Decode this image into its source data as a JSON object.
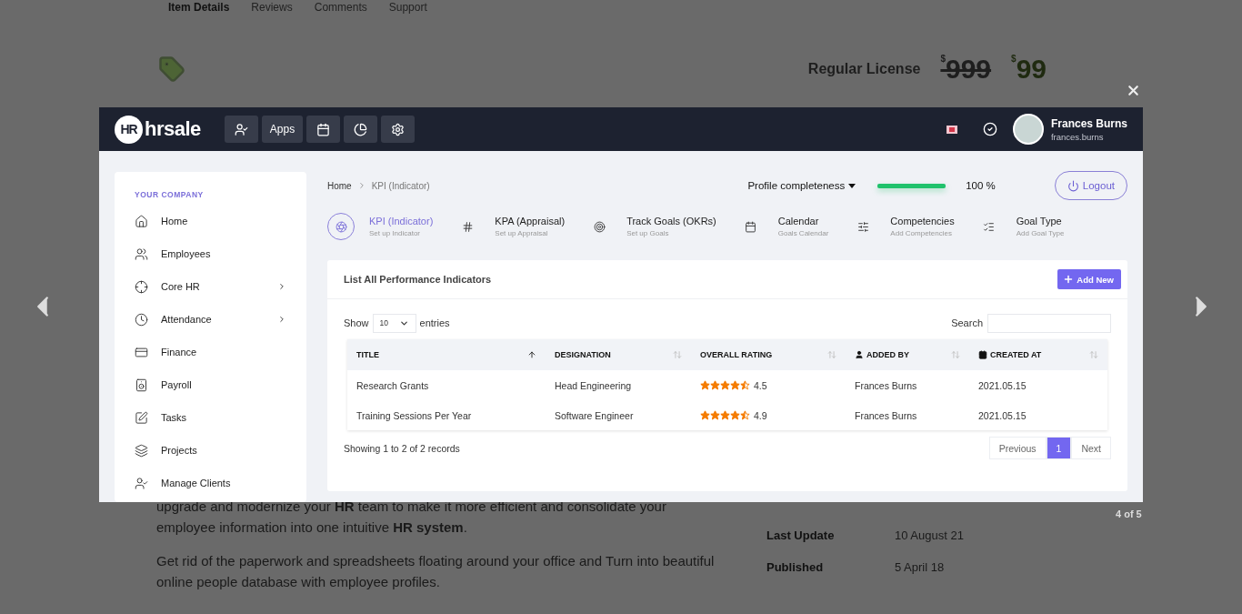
{
  "background_page": {
    "tabs": [
      {
        "label": "Item Details",
        "selected": true
      },
      {
        "label": "Reviews",
        "selected": false
      },
      {
        "label": "Comments",
        "selected": false
      },
      {
        "label": "Support",
        "selected": false
      }
    ],
    "license": {
      "label": "Regular License",
      "currency": "$",
      "old_price": "999",
      "price": "99"
    },
    "description": [
      "upgrade and modernize your **HR** team to make it more efficient and consolidate your employee information into one intuitive **HR system**.",
      "Get rid of the paperwork and spreadsheets floating around your office and Turn into beautiful online people database with employee profiles."
    ],
    "meta": [
      {
        "label": "Last Update",
        "value": "10 August 21"
      },
      {
        "label": "Published",
        "value": "5 April 18"
      }
    ]
  },
  "lightbox": {
    "counter": "4 of 5"
  },
  "app": {
    "brand": {
      "mark": "HR",
      "name": "hrsale"
    },
    "toolbar": [
      {
        "kind": "icon"
      },
      {
        "kind": "text",
        "label": "Apps"
      },
      {
        "kind": "icon"
      },
      {
        "kind": "icon"
      },
      {
        "kind": "icon"
      }
    ],
    "user": {
      "name": "Frances Burns",
      "username": "frances.burns"
    },
    "sidebar": {
      "heading": "YOUR COMPANY",
      "items": [
        {
          "label": "Home",
          "submenu": false
        },
        {
          "label": "Employees",
          "submenu": false
        },
        {
          "label": "Core HR",
          "submenu": true
        },
        {
          "label": "Attendance",
          "submenu": true
        },
        {
          "label": "Finance",
          "submenu": false
        },
        {
          "label": "Payroll",
          "submenu": false
        },
        {
          "label": "Tasks",
          "submenu": false
        },
        {
          "label": "Projects",
          "submenu": false
        },
        {
          "label": "Manage Clients",
          "submenu": false
        }
      ]
    },
    "breadcrumb": [
      "Home",
      "KPI (Indicator)"
    ],
    "profile": {
      "label": "Profile completeness",
      "level": 1,
      "reading": "100 %"
    },
    "logout": "Logout",
    "modules": [
      {
        "title": "KPI (Indicator)",
        "subtitle": "Set up Indicator",
        "selected": true
      },
      {
        "title": "KPA (Appraisal)",
        "subtitle": "Set up Appraisal",
        "selected": false
      },
      {
        "title": "Track Goals (OKRs)",
        "subtitle": "Set up Goals",
        "selected": false
      },
      {
        "title": "Calendar",
        "subtitle": "Goals Calendar",
        "selected": false
      },
      {
        "title": "Competencies",
        "subtitle": "Add Competencies",
        "selected": false
      },
      {
        "title": "Goal Type",
        "subtitle": "Add Goal Type",
        "selected": false
      }
    ],
    "card": {
      "title": "List All Performance Indicators",
      "add_button": "Add New",
      "show_label": "Show",
      "page_size": "10",
      "entries_label": "entries",
      "search_label": "Search",
      "columns": [
        {
          "label": "TITLE",
          "sorted": true
        },
        {
          "label": "DESIGNATION",
          "sorted": false
        },
        {
          "label": "OVERALL RATING",
          "sorted": false
        },
        {
          "label": "ADDED BY",
          "sorted": false
        },
        {
          "label": "CREATED AT",
          "sorted": false
        }
      ],
      "rows": [
        {
          "title": "Research Grants",
          "designation": "Head Engineering",
          "stars": 4.5,
          "rating": "4.5",
          "added_by": "Frances Burns",
          "created_at": "2021.05.15"
        },
        {
          "title": "Training Sessions Per Year",
          "designation": "Software Engineer",
          "stars": 4.5,
          "rating": "4.9",
          "added_by": "Frances Burns",
          "created_at": "2021.05.15"
        }
      ],
      "summary": "Showing 1 to 2 of 2 records",
      "pagination": {
        "previous": "Previous",
        "pages": [
          {
            "label": "1",
            "selected": true
          }
        ],
        "next": "Next"
      }
    }
  }
}
